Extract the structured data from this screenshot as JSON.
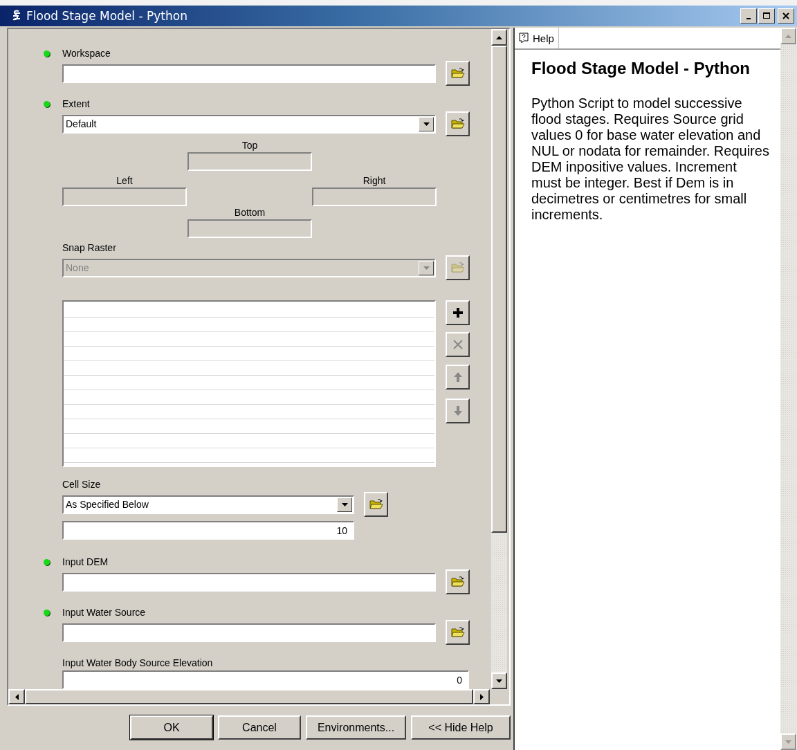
{
  "window": {
    "title": "Flood Stage Model - Python"
  },
  "parameters": [
    {
      "kind": "path",
      "label": "Workspace",
      "required": true
    },
    {
      "kind": "extent",
      "label": "Extent",
      "required": true,
      "value": "Default",
      "bounds": [
        {
          "label": "Top",
          "disabled": true
        },
        {
          "label": "Left",
          "disabled": true
        },
        {
          "label": "Right",
          "disabled": true
        },
        {
          "label": "Bottom",
          "disabled": true
        }
      ]
    },
    {
      "kind": "dropdown",
      "label": "Snap Raster",
      "required": false,
      "value": "None",
      "disabled": true
    },
    {
      "kind": "list",
      "buttons": [
        {
          "kind": "add",
          "disabled": false
        },
        {
          "kind": "remove",
          "disabled": true
        },
        {
          "kind": "up",
          "disabled": true
        },
        {
          "kind": "down",
          "disabled": true
        }
      ]
    },
    {
      "kind": "cellsize",
      "label": "Cell Size",
      "required": false,
      "value": "As Specified Below",
      "size": "10"
    },
    {
      "kind": "path",
      "label": "Input DEM",
      "required": true
    },
    {
      "kind": "path",
      "label": "Input Water Source",
      "required": true
    },
    {
      "kind": "number",
      "label": "Input Water Body Source Elevation",
      "required": false,
      "value": "0"
    }
  ],
  "buttons": [
    {
      "label": "OK",
      "default": true
    },
    {
      "label": "Cancel",
      "default": false
    },
    {
      "label": "Environments...",
      "default": false
    },
    {
      "label": "<< Hide Help",
      "default": false
    }
  ],
  "help": {
    "tab": "Help",
    "heading": "Flood Stage Model - Python",
    "body": "Python Script to model successive flood stages. Requires Source grid values 0 for base water elevation and NUL or nodata for remainder. Requires DEM inpositive values. Increment must be integer. Best if Dem is in decimetres or centimetres for small increments."
  }
}
